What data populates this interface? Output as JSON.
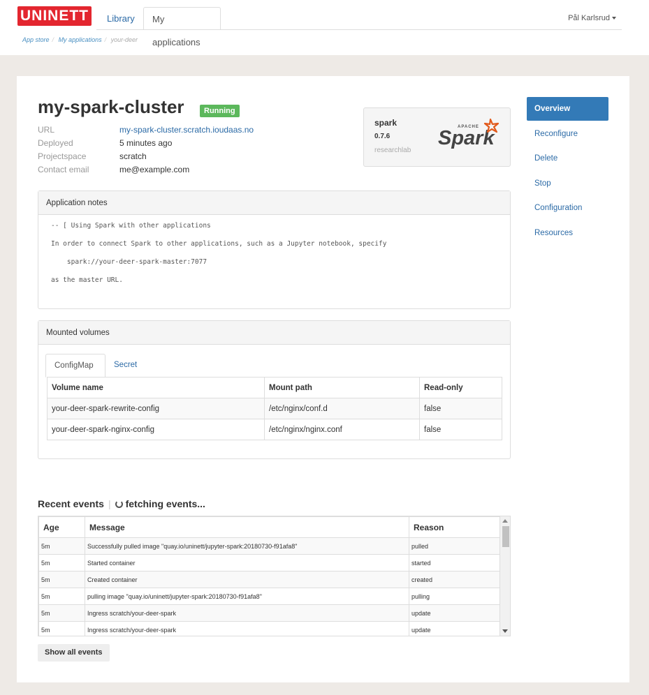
{
  "header": {
    "logo": "UNINETT",
    "tabs": [
      {
        "label": "Library"
      },
      {
        "label": "My applications"
      }
    ],
    "user": "Pål Karlsrud"
  },
  "breadcrumb": [
    "App store",
    "My applications",
    "your-deer"
  ],
  "app": {
    "title": "my-spark-cluster",
    "status": "Running",
    "details": [
      {
        "key": "URL",
        "value": "my-spark-cluster.scratch.ioudaas.no"
      },
      {
        "key": "Deployed",
        "value": "5 minutes ago"
      },
      {
        "key": "Projectspace",
        "value": "scratch"
      },
      {
        "key": "Contact email",
        "value": "me@example.com"
      }
    ]
  },
  "package": {
    "name": "spark",
    "version": "0.7.6",
    "repo": "researchlab",
    "logo_apache": "APACHE",
    "logo_word": "Spark"
  },
  "sidenav": [
    "Overview",
    "Reconfigure",
    "Delete",
    "Stop",
    "Configuration",
    "Resources"
  ],
  "notes": {
    "heading": "Application notes",
    "lines": [
      "-- [ Using Spark with other applications",
      "In order to connect Spark to other applications, such as a Jupyter notebook, specify",
      "    spark://your-deer-spark-master:7077",
      "as the master URL."
    ]
  },
  "volumes": {
    "heading": "Mounted volumes",
    "tabs": [
      "ConfigMap",
      "Secret"
    ],
    "columns": [
      "Volume name",
      "Mount path",
      "Read-only"
    ],
    "rows": [
      [
        "your-deer-spark-rewrite-config",
        "/etc/nginx/conf.d",
        "false"
      ],
      [
        "your-deer-spark-nginx-config",
        "/etc/nginx/nginx.conf",
        "false"
      ]
    ]
  },
  "events": {
    "heading": "Recent events",
    "fetching": "fetching events...",
    "columns": [
      "Age",
      "Message",
      "Reason"
    ],
    "rows": [
      [
        "5m",
        "Successfully pulled image \"quay.io/uninett/jupyter-spark:20180730-f91afa8\"",
        "pulled"
      ],
      [
        "5m",
        "Started container",
        "started"
      ],
      [
        "5m",
        "Created container",
        "created"
      ],
      [
        "5m",
        "pulling image \"quay.io/uninett/jupyter-spark:20180730-f91afa8\"",
        "pulling"
      ],
      [
        "5m",
        "Ingress scratch/your-deer-spark",
        "update"
      ],
      [
        "5m",
        "Ingress scratch/your-deer-spark",
        "update"
      ]
    ],
    "show_all": "Show all events"
  }
}
